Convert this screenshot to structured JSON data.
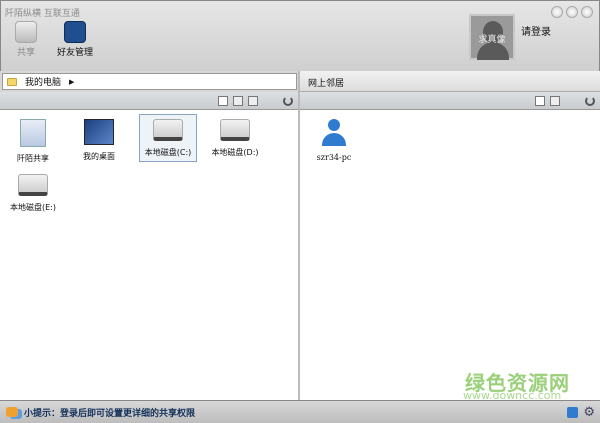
{
  "app": {
    "title": "阡陌纵横 互联互通"
  },
  "toolbar": {
    "share": "共享",
    "friends": "好友管理"
  },
  "user": {
    "avatar_label": "求真像",
    "login": "请登录"
  },
  "left": {
    "address": "我的电脑",
    "items": [
      {
        "label": "阡陌共享",
        "icon": "share-icon"
      },
      {
        "label": "我的桌面",
        "icon": "desktop-icon"
      },
      {
        "label": "本地磁盘(C:)",
        "icon": "drive-icon",
        "selected": true
      },
      {
        "label": "本地磁盘(D:)",
        "icon": "drive-icon"
      },
      {
        "label": "本地磁盘(E:)",
        "icon": "drive-icon"
      }
    ]
  },
  "right": {
    "title": "网上邻居",
    "items": [
      {
        "label": "szr34-pc",
        "icon": "user-icon"
      }
    ]
  },
  "status": {
    "tip": "小提示：登录后即可设置更详细的共享权限"
  },
  "watermark": {
    "cn": "绿色资源网",
    "url": "www.downcc.com"
  }
}
